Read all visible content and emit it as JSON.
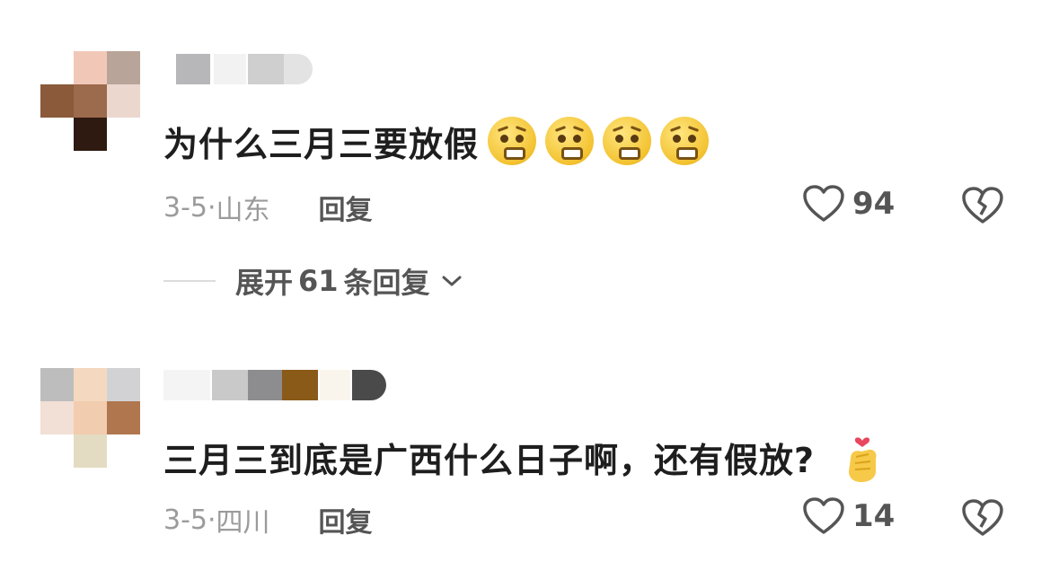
{
  "comments": [
    {
      "text": "为什么三月三要放假",
      "emoji_count": 4,
      "emoji_icon": "pleading-face-emoji",
      "date": "3-5·",
      "location": "山东",
      "reply_label": "回复",
      "likes": "94",
      "expand": {
        "prefix": "展开",
        "count": "61",
        "suffix": "条回复"
      }
    },
    {
      "text": "三月三到底是广西什么日子啊，还有假放?",
      "emoji_icon": "finger-heart-emoji",
      "date": "3-5·",
      "location": "四川",
      "reply_label": "回复",
      "likes": "14"
    }
  ],
  "colors": {
    "text": "#1e1e1e",
    "meta": "#9b9b9b",
    "action": "#555555",
    "emoji": "#f3c230",
    "heart_accent": "#e8475e"
  }
}
